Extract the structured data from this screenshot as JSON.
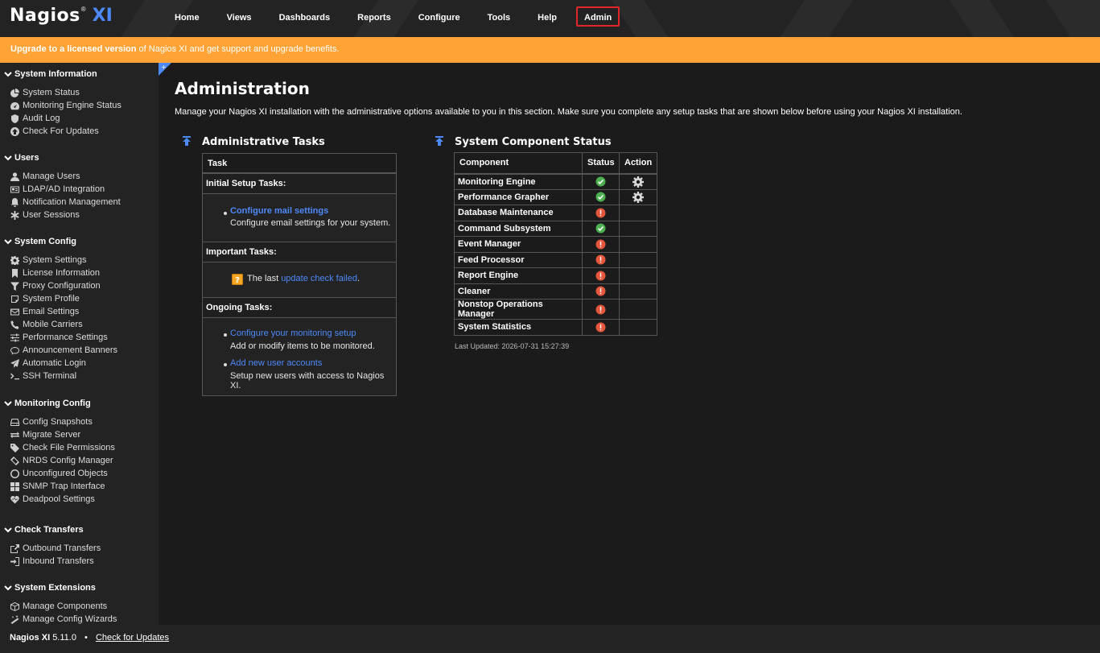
{
  "header": {
    "logo_main": "Nagios",
    "logo_reg": "®",
    "logo_suffix": "XI",
    "nav": [
      {
        "label": "Home"
      },
      {
        "label": "Views"
      },
      {
        "label": "Dashboards"
      },
      {
        "label": "Reports"
      },
      {
        "label": "Configure"
      },
      {
        "label": "Tools"
      },
      {
        "label": "Help"
      },
      {
        "label": "Admin",
        "active": true
      }
    ]
  },
  "banner": {
    "strong": "Upgrade to a licensed version",
    "rest": " of Nagios XI and get support and upgrade benefits."
  },
  "sidebar": {
    "sections": [
      {
        "title": "System Information",
        "items": [
          {
            "label": "System Status",
            "icon": "pie-chart-icon"
          },
          {
            "label": "Monitoring Engine Status",
            "icon": "tachometer-icon"
          },
          {
            "label": "Audit Log",
            "icon": "shield-icon"
          },
          {
            "label": "Check For Updates",
            "icon": "arrow-circle-up-icon"
          }
        ]
      },
      {
        "title": "Users",
        "items": [
          {
            "label": "Manage Users",
            "icon": "user-icon"
          },
          {
            "label": "LDAP/AD Integration",
            "icon": "id-card-icon"
          },
          {
            "label": "Notification Management",
            "icon": "bell-icon"
          },
          {
            "label": "User Sessions",
            "icon": "asterisk-icon"
          }
        ]
      },
      {
        "title": "System Config",
        "items": [
          {
            "label": "System Settings",
            "icon": "gear-icon"
          },
          {
            "label": "License Information",
            "icon": "bookmark-icon"
          },
          {
            "label": "Proxy Configuration",
            "icon": "filter-icon"
          },
          {
            "label": "System Profile",
            "icon": "sticky-note-icon"
          },
          {
            "label": "Email Settings",
            "icon": "envelope-icon"
          },
          {
            "label": "Mobile Carriers",
            "icon": "phone-icon"
          },
          {
            "label": "Performance Settings",
            "icon": "sliders-icon"
          },
          {
            "label": "Announcement Banners",
            "icon": "comment-icon"
          },
          {
            "label": "Automatic Login",
            "icon": "paper-plane-icon"
          },
          {
            "label": "SSH Terminal",
            "icon": "terminal-icon"
          }
        ]
      },
      {
        "title": "Monitoring Config",
        "items": [
          {
            "label": "Config Snapshots",
            "icon": "hdd-icon"
          },
          {
            "label": "Migrate Server",
            "icon": "exchange-icon"
          },
          {
            "label": "Check File Permissions",
            "icon": "tag-icon"
          },
          {
            "label": "NRDS Config Manager",
            "icon": "ticket-icon"
          },
          {
            "label": "Unconfigured Objects",
            "icon": "circle-o-icon"
          },
          {
            "label": "SNMP Trap Interface",
            "icon": "th-large-icon"
          },
          {
            "label": "Deadpool Settings",
            "icon": "heartbeat-icon"
          }
        ]
      },
      {
        "title": "Check Transfers",
        "items": [
          {
            "label": "Outbound Transfers",
            "icon": "share-square-icon"
          },
          {
            "label": "Inbound Transfers",
            "icon": "sign-in-icon"
          }
        ]
      },
      {
        "title": "System Extensions",
        "items": [
          {
            "label": "Manage Components",
            "icon": "cube-icon"
          },
          {
            "label": "Manage Config Wizards",
            "icon": "magic-icon"
          }
        ]
      }
    ]
  },
  "main": {
    "title": "Administration",
    "description": "Manage your Nagios XI installation with the administrative options available to you in this section. Make sure you complete any setup tasks that are shown below before using your Nagios XI installation.",
    "admin_tasks": {
      "title": "Administrative Tasks",
      "column": "Task",
      "initial_label": "Initial Setup Tasks:",
      "initial_link": "Configure mail settings",
      "initial_desc": "Configure email settings for your system.",
      "important_label": "Important Tasks:",
      "important_prefix": "The last ",
      "important_link": "update check failed",
      "important_suffix": ".",
      "ongoing_label": "Ongoing Tasks:",
      "ongoing_link1": "Configure your monitoring setup",
      "ongoing_desc1": "Add or modify items to be monitored.",
      "ongoing_link2": "Add new user accounts",
      "ongoing_desc2": "Setup new users with access to Nagios XI."
    },
    "component_status": {
      "title": "System Component Status",
      "columns": [
        "Component",
        "Status",
        "Action"
      ],
      "rows": [
        {
          "name": "Monitoring Engine",
          "status": "ok",
          "action": true
        },
        {
          "name": "Performance Grapher",
          "status": "ok",
          "action": true
        },
        {
          "name": "Database Maintenance",
          "status": "error",
          "action": false
        },
        {
          "name": "Command Subsystem",
          "status": "ok",
          "action": false
        },
        {
          "name": "Event Manager",
          "status": "error",
          "action": false
        },
        {
          "name": "Feed Processor",
          "status": "error",
          "action": false
        },
        {
          "name": "Report Engine",
          "status": "error",
          "action": false
        },
        {
          "name": "Cleaner",
          "status": "error",
          "action": false
        },
        {
          "name": "Nonstop Operations Manager",
          "status": "error",
          "action": false
        },
        {
          "name": "System Statistics",
          "status": "error",
          "action": false
        }
      ],
      "last_updated": "Last Updated: 2026-07-31 15:27:39"
    }
  },
  "footer": {
    "product": "Nagios XI",
    "version": "5.11.0",
    "separator": "•",
    "link": "Check for Updates"
  },
  "colors": {
    "banner": "#ffa336",
    "link": "#4d89f9",
    "ok": "#4caf50",
    "error": "#e4573d",
    "active_nav_border": "#e0262b"
  }
}
